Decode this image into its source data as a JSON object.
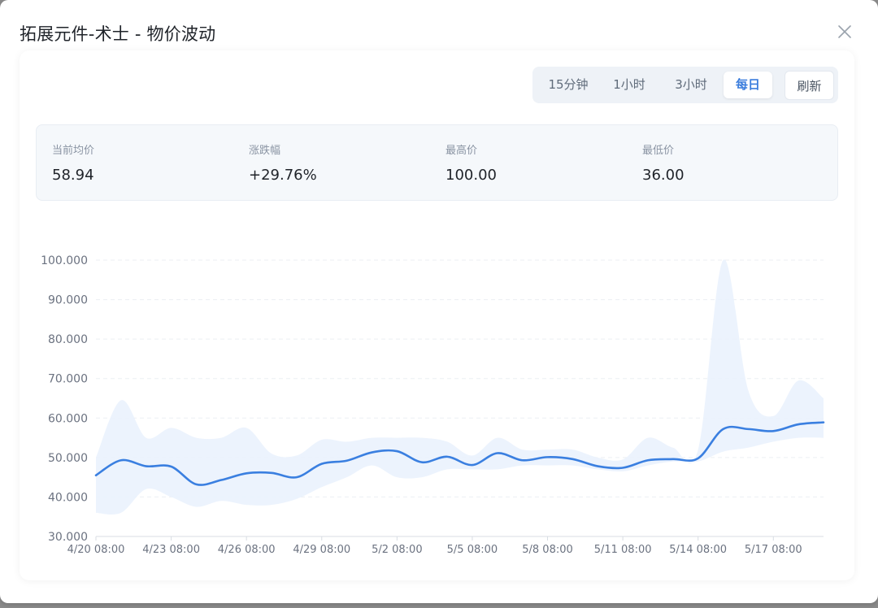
{
  "dialog": {
    "title": "拓展元件-术士 - 物价波动"
  },
  "icons": {
    "close": "close-icon"
  },
  "toolbar": {
    "intervals": [
      "15分钟",
      "1小时",
      "3小时",
      "每日"
    ],
    "active_interval": "每日",
    "refresh_label": "刷新"
  },
  "stats": {
    "current_avg_label": "当前均价",
    "current_avg_value": "58.94",
    "change_label": "涨跌幅",
    "change_value": "+29.76%",
    "high_label": "最高价",
    "high_value": "100.00",
    "low_label": "最低价",
    "low_value": "36.00"
  },
  "colors": {
    "line": "#3a7fe0",
    "band": "#eaf2fd",
    "accent": "#3b7ddd"
  },
  "chart_data": {
    "type": "area",
    "title": "",
    "xlabel": "",
    "ylabel": "",
    "ylim": [
      30,
      100
    ],
    "y_ticks": [
      "30.000",
      "40.000",
      "50.000",
      "60.000",
      "70.000",
      "80.000",
      "90.000",
      "100.000"
    ],
    "grid": true,
    "x_ticks": [
      "4/20 08:00",
      "4/23 08:00",
      "4/26 08:00",
      "4/29 08:00",
      "5/2 08:00",
      "5/5 08:00",
      "5/8 08:00",
      "5/11 08:00",
      "5/14 08:00",
      "5/17 08:00"
    ],
    "x": [
      "4/20",
      "4/21",
      "4/22",
      "4/23",
      "4/24",
      "4/25",
      "4/26",
      "4/27",
      "4/28",
      "4/29",
      "4/30",
      "5/1",
      "5/2",
      "5/3",
      "5/4",
      "5/5",
      "5/6",
      "5/7",
      "5/8",
      "5/9",
      "5/10",
      "5/11",
      "5/12",
      "5/13",
      "5/14",
      "5/15",
      "5/16",
      "5/17",
      "5/18",
      "5/19"
    ],
    "series": [
      {
        "role": "average",
        "values": [
          45.5,
          49.3,
          47.8,
          47.7,
          43.2,
          44.3,
          46.0,
          46.1,
          45.0,
          48.4,
          49.2,
          51.3,
          51.6,
          48.8,
          50.2,
          48.1,
          51.1,
          49.3,
          50.1,
          49.6,
          47.8,
          47.4,
          49.3,
          49.6,
          49.8,
          57.2,
          57.2,
          56.7,
          58.4,
          58.9
        ]
      },
      {
        "role": "high",
        "values": [
          50.0,
          64.5,
          55.0,
          57.5,
          55.0,
          55.0,
          57.5,
          51.0,
          50.5,
          54.5,
          54.0,
          55.0,
          55.0,
          55.0,
          54.0,
          50.5,
          55.0,
          52.0,
          52.0,
          52.0,
          50.0,
          49.5,
          55.0,
          52.5,
          52.0,
          100.0,
          67.0,
          60.5,
          69.5,
          65.0
        ]
      },
      {
        "role": "low",
        "values": [
          36.0,
          36.0,
          42.0,
          40.0,
          37.5,
          39.0,
          38.0,
          38.0,
          39.5,
          42.5,
          45.0,
          48.0,
          45.0,
          45.0,
          47.0,
          47.0,
          47.0,
          48.0,
          48.0,
          48.0,
          47.0,
          46.5,
          48.0,
          49.0,
          49.0,
          51.5,
          52.5,
          54.0,
          55.0,
          55.0
        ]
      }
    ]
  }
}
